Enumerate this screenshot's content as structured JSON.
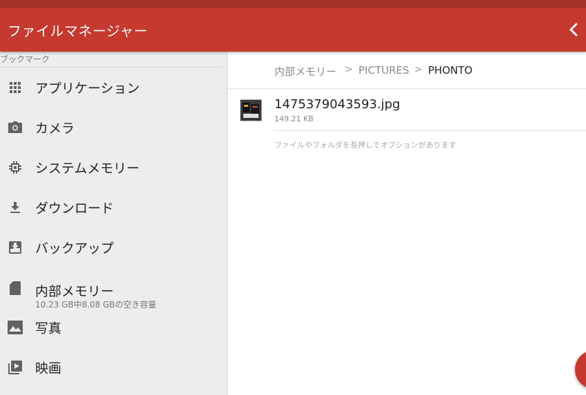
{
  "app": {
    "title": "ファイルマネージャー",
    "accent_color": "#c5392f",
    "status_color": "#a3312a"
  },
  "drawer": {
    "section_label": "ブックマーク",
    "items": [
      {
        "label": "アプリケーション",
        "icon": "apps-grid-icon"
      },
      {
        "label": "カメラ",
        "icon": "camera-icon"
      },
      {
        "label": "システムメモリー",
        "icon": "chip-icon"
      },
      {
        "label": "ダウンロード",
        "icon": "download-icon"
      },
      {
        "label": "バックアップ",
        "icon": "backup-icon"
      },
      {
        "label": "内部メモリー",
        "sublabel": "10.23 GB中8.08 GBの空き容量",
        "icon": "sd-card-icon"
      },
      {
        "label": "写真",
        "icon": "image-icon"
      },
      {
        "label": "映画",
        "icon": "video-library-icon"
      }
    ]
  },
  "breadcrumb": {
    "items": [
      "内部メモリー",
      "PICTURES",
      "PHONTO"
    ],
    "separator": ">"
  },
  "files": [
    {
      "name": "1475379043593.jpg",
      "size": "149.21 KB",
      "icon": "image-thumbnail"
    }
  ],
  "hint": "ファイルやフォルダを長押しでオプションがあります"
}
